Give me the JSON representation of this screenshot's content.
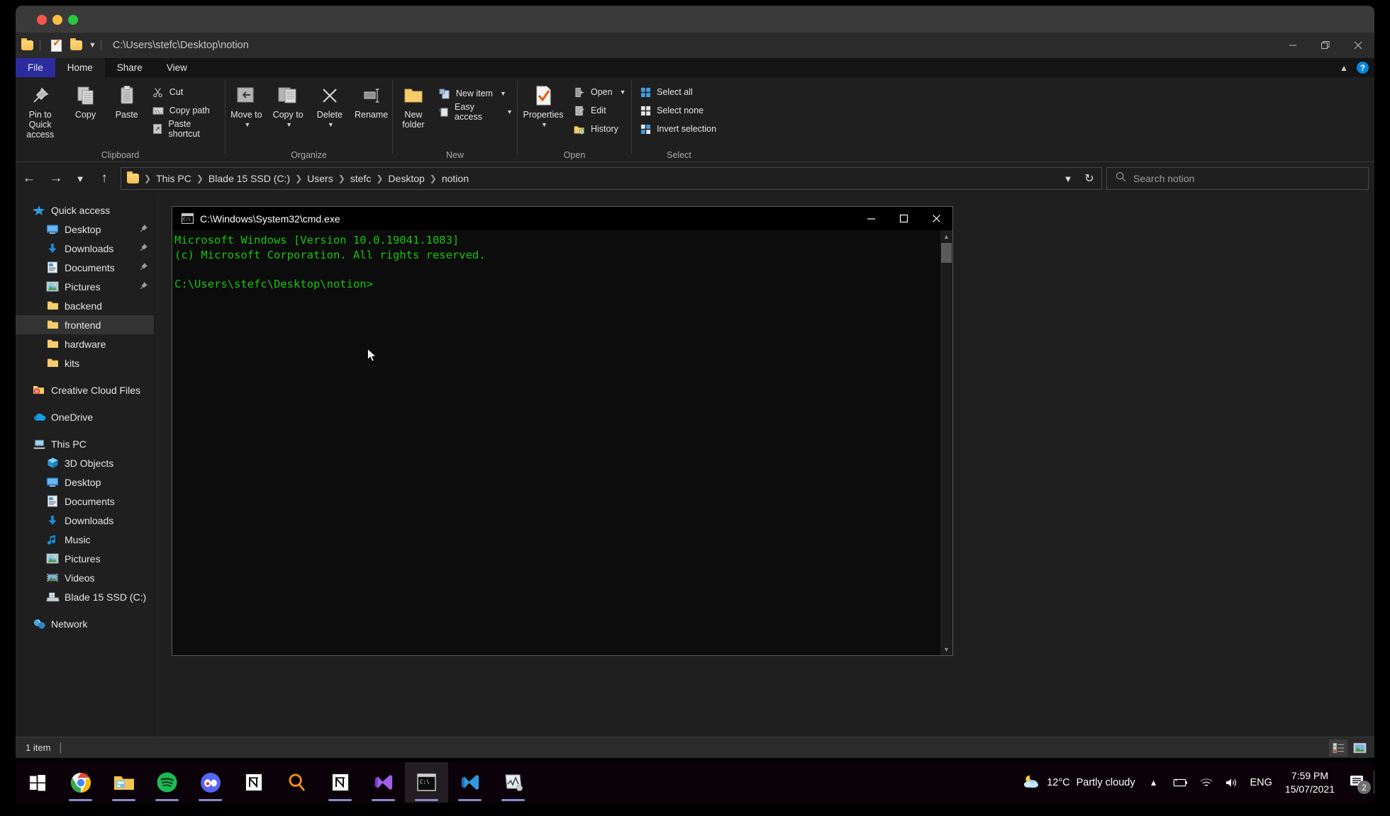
{
  "mac_window": {
    "close_label": "close",
    "minimize_label": "minimize",
    "maximize_label": "maximize"
  },
  "explorer": {
    "quick_access_toolbar": {
      "path_text": "C:\\Users\\stefc\\Desktop\\notion",
      "icons": [
        "folder-icon",
        "properties-icon",
        "new-folder-icon",
        "customize-caret-icon"
      ]
    },
    "window_controls": {
      "minimize": "minimize-icon",
      "restore": "restore-icon",
      "close": "close-icon"
    },
    "tabs": [
      {
        "label": "File",
        "state": "file"
      },
      {
        "label": "Home",
        "state": "active"
      },
      {
        "label": "Share",
        "state": "normal"
      },
      {
        "label": "View",
        "state": "normal"
      }
    ],
    "ribbon_collapse": "chevron-up-icon",
    "help_label": "?",
    "ribbon": {
      "groups": [
        {
          "label": "Clipboard",
          "big_buttons": [
            {
              "label": "Pin to Quick access",
              "icon": "pin-icon"
            },
            {
              "label": "Copy",
              "icon": "copy-icon"
            },
            {
              "label": "Paste",
              "icon": "paste-icon"
            }
          ],
          "small_buttons": [
            {
              "label": "Cut",
              "icon": "scissors-icon"
            },
            {
              "label": "Copy path",
              "icon": "copy-path-icon"
            },
            {
              "label": "Paste shortcut",
              "icon": "paste-shortcut-icon"
            }
          ]
        },
        {
          "label": "Organize",
          "big_buttons": [
            {
              "label": "Move to",
              "icon": "move-to-icon",
              "dropdown": true
            },
            {
              "label": "Copy to",
              "icon": "copy-to-icon",
              "dropdown": true
            },
            {
              "label": "Delete",
              "icon": "delete-icon",
              "dropdown": true
            },
            {
              "label": "Rename",
              "icon": "rename-icon"
            }
          ],
          "small_buttons": []
        },
        {
          "label": "New",
          "big_buttons": [
            {
              "label": "New folder",
              "icon": "new-folder-icon"
            }
          ],
          "small_buttons": [
            {
              "label": "New item",
              "icon": "new-item-icon",
              "dropdown": true
            },
            {
              "label": "Easy access",
              "icon": "easy-access-icon",
              "dropdown": true
            }
          ]
        },
        {
          "label": "Open",
          "big_buttons": [
            {
              "label": "Properties",
              "icon": "properties-icon",
              "dropdown": true
            }
          ],
          "small_buttons": [
            {
              "label": "Open",
              "icon": "open-icon",
              "dropdown": true
            },
            {
              "label": "Edit",
              "icon": "edit-icon"
            },
            {
              "label": "History",
              "icon": "history-icon"
            }
          ]
        },
        {
          "label": "Select",
          "big_buttons": [],
          "small_buttons": [
            {
              "label": "Select all",
              "icon": "select-all-icon"
            },
            {
              "label": "Select none",
              "icon": "select-none-icon"
            },
            {
              "label": "Invert selection",
              "icon": "invert-selection-icon"
            }
          ]
        }
      ]
    },
    "navigation": {
      "back": "back-arrow-icon",
      "forward": "forward-arrow-icon",
      "recent": "chevron-down-icon",
      "up": "up-arrow-icon",
      "breadcrumbs": [
        "This PC",
        "Blade 15 SSD (C:)",
        "Users",
        "stefc",
        "Desktop",
        "notion"
      ],
      "history_caret": "chevron-down-icon",
      "refresh": "refresh-icon"
    },
    "search": {
      "placeholder": "Search notion",
      "value": "",
      "icon": "search-icon"
    },
    "sidebar": [
      {
        "label": "Quick access",
        "icon": "quick-access-star-icon",
        "level": 0,
        "selected": false,
        "pinned": false,
        "spacer_after": false
      },
      {
        "label": "Desktop",
        "icon": "desktop-icon",
        "level": 1,
        "selected": false,
        "pinned": true,
        "spacer_after": false
      },
      {
        "label": "Downloads",
        "icon": "downloads-icon",
        "level": 1,
        "selected": false,
        "pinned": true,
        "spacer_after": false
      },
      {
        "label": "Documents",
        "icon": "documents-icon",
        "level": 1,
        "selected": false,
        "pinned": true,
        "spacer_after": false
      },
      {
        "label": "Pictures",
        "icon": "pictures-icon",
        "level": 1,
        "selected": false,
        "pinned": true,
        "spacer_after": false
      },
      {
        "label": "backend",
        "icon": "folder-icon",
        "level": 1,
        "selected": false,
        "pinned": false,
        "spacer_after": false
      },
      {
        "label": "frontend",
        "icon": "folder-icon",
        "level": 1,
        "selected": true,
        "pinned": false,
        "spacer_after": false
      },
      {
        "label": "hardware",
        "icon": "folder-icon",
        "level": 1,
        "selected": false,
        "pinned": false,
        "spacer_after": false
      },
      {
        "label": "kits",
        "icon": "folder-icon",
        "level": 1,
        "selected": false,
        "pinned": false,
        "spacer_after": true
      },
      {
        "label": "Creative Cloud Files",
        "icon": "creative-cloud-icon",
        "level": 0,
        "selected": false,
        "pinned": false,
        "spacer_after": true
      },
      {
        "label": "OneDrive",
        "icon": "onedrive-icon",
        "level": 0,
        "selected": false,
        "pinned": false,
        "spacer_after": true
      },
      {
        "label": "This PC",
        "icon": "this-pc-icon",
        "level": 0,
        "selected": false,
        "pinned": false,
        "spacer_after": false
      },
      {
        "label": "3D Objects",
        "icon": "3d-objects-icon",
        "level": 1,
        "selected": false,
        "pinned": false,
        "spacer_after": false
      },
      {
        "label": "Desktop",
        "icon": "desktop-icon",
        "level": 1,
        "selected": false,
        "pinned": false,
        "spacer_after": false
      },
      {
        "label": "Documents",
        "icon": "documents-icon",
        "level": 1,
        "selected": false,
        "pinned": false,
        "spacer_after": false
      },
      {
        "label": "Downloads",
        "icon": "downloads-icon",
        "level": 1,
        "selected": false,
        "pinned": false,
        "spacer_after": false
      },
      {
        "label": "Music",
        "icon": "music-icon",
        "level": 1,
        "selected": false,
        "pinned": false,
        "spacer_after": false
      },
      {
        "label": "Pictures",
        "icon": "pictures-icon",
        "level": 1,
        "selected": false,
        "pinned": false,
        "spacer_after": false
      },
      {
        "label": "Videos",
        "icon": "videos-icon",
        "level": 1,
        "selected": false,
        "pinned": false,
        "spacer_after": false
      },
      {
        "label": "Blade 15 SSD (C:)",
        "icon": "drive-icon",
        "level": 1,
        "selected": false,
        "pinned": false,
        "spacer_after": true
      },
      {
        "label": "Network",
        "icon": "network-icon",
        "level": 0,
        "selected": false,
        "pinned": false,
        "spacer_after": false
      }
    ],
    "status_bar": {
      "item_count": "1 item",
      "divider": "|",
      "view_details": "details-view-icon",
      "view_large_icons": "large-icons-view-icon"
    }
  },
  "cmd_window": {
    "title": "C:\\Windows\\System32\\cmd.exe",
    "icon": "cmd-icon",
    "controls": {
      "minimize": "minimize-icon",
      "maximize": "maximize-icon",
      "close": "close-icon"
    },
    "lines": [
      "Microsoft Windows [Version 10.0.19041.1083]",
      "(c) Microsoft Corporation. All rights reserved.",
      "",
      "C:\\Users\\stefc\\Desktop\\notion>"
    ],
    "text_color": "#16c60c",
    "background_color": "#0c0c0c",
    "scrollbar": {
      "up": "scroll-up-icon",
      "down": "scroll-down-icon"
    }
  },
  "taskbar": {
    "items": [
      {
        "name": "start-button",
        "icon": "windows-logo-icon",
        "running": false,
        "active": false
      },
      {
        "name": "chrome",
        "icon": "chrome-icon",
        "running": true,
        "active": false
      },
      {
        "name": "file-explorer",
        "icon": "file-explorer-icon",
        "running": true,
        "active": false
      },
      {
        "name": "spotify",
        "icon": "spotify-icon",
        "running": true,
        "active": false
      },
      {
        "name": "discord",
        "icon": "discord-icon",
        "running": true,
        "active": false
      },
      {
        "name": "notion",
        "icon": "notion-icon",
        "running": false,
        "active": false
      },
      {
        "name": "search",
        "icon": "search-magnifier-icon",
        "running": false,
        "active": false
      },
      {
        "name": "notion-2",
        "icon": "notion-icon",
        "running": true,
        "active": false
      },
      {
        "name": "visual-studio",
        "icon": "visual-studio-icon",
        "running": true,
        "active": false
      },
      {
        "name": "command-prompt",
        "icon": "cmd-icon",
        "running": true,
        "active": true
      },
      {
        "name": "vs-code",
        "icon": "vscode-icon",
        "running": true,
        "active": false
      },
      {
        "name": "system-monitor",
        "icon": "system-monitor-icon",
        "running": true,
        "active": false
      }
    ],
    "tray": {
      "weather_icon": "partly-cloudy-night-icon",
      "temperature": "12°C",
      "weather_text": "Partly cloudy",
      "show_hidden": "chevron-up-icon",
      "battery": "battery-charging-icon",
      "network": "wifi-icon",
      "volume": "speaker-icon",
      "language": "ENG",
      "time": "7:59 PM",
      "date": "15/07/2021",
      "notifications_icon": "notifications-icon",
      "notifications_count": "2"
    }
  },
  "colors": {
    "accent": "#2b2b9e",
    "selection": "#333333",
    "terminal_green": "#16c60c",
    "taskbar_underline": "#8a8acb"
  }
}
